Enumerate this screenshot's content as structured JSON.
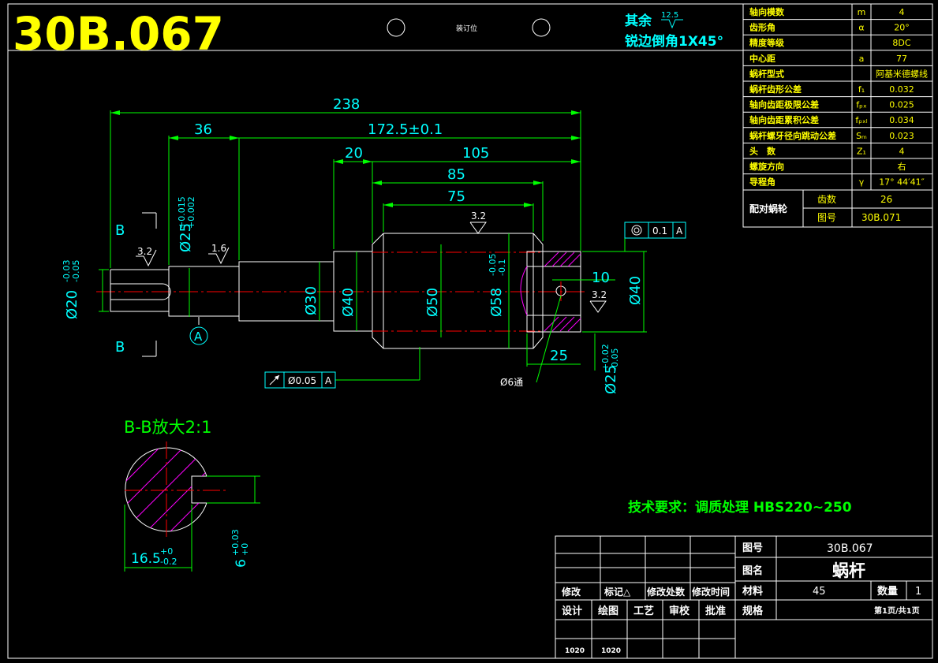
{
  "drawing_number_big": "30B.067",
  "binding_mark": "装订位",
  "surface_note": {
    "line1": "其余",
    "line1_roughness": "12.5",
    "line2": "锐边倒角1X45°"
  },
  "tech_requirement": "技术要求：调质处理 HBS220~250",
  "section_title": "B-B放大2:1",
  "dims": {
    "d238": "238",
    "d36": "36",
    "d172": "172.5±0.1",
    "d20": "20",
    "d105": "105",
    "d85": "85",
    "d75": "75",
    "d10": "10",
    "d25": "25",
    "phi30": "Ø30",
    "phi40a": "Ø40",
    "phi50": "Ø50",
    "phi40b": "Ø40",
    "phi58": "Ø58",
    "phi58_up": "-0.05",
    "phi58_lo": "-0.1",
    "phi20": "Ø20",
    "phi20_up": "-0.03",
    "phi20_lo": "-0.05",
    "phi25a": "Ø25",
    "phi25a_up": "+0.015",
    "phi25a_lo": "+0.002",
    "phi25b": "Ø25",
    "phi25b_up": "+0.02",
    "phi25b_lo": "-0.05",
    "hole": "Ø6通",
    "rough32a": "3.2",
    "rough16": "1.6",
    "rough32b": "3.2",
    "rough32c": "3.2",
    "datum_a": "A",
    "sectionB_top": "B",
    "sectionB_bot": "B",
    "runout_tol": "Ø0.05",
    "runout_ref": "A",
    "conc_tol": "0.1",
    "conc_ref": "A",
    "sec_width": "16.5",
    "sec_width_up": "+0",
    "sec_width_lo": "-0.2",
    "sec_key": "6",
    "sec_key_up": "+0.03",
    "sec_key_lo": "+0"
  },
  "params_table": [
    {
      "name": "轴向模数",
      "sym": "m",
      "val": "4"
    },
    {
      "name": "齿形角",
      "sym": "α",
      "val": "20°"
    },
    {
      "name": "精度等级",
      "sym": "",
      "val": "8DC"
    },
    {
      "name": "中心距",
      "sym": "a",
      "val": "77"
    },
    {
      "name": "蜗杆型式",
      "sym": "",
      "val": "阿基米德螺线"
    },
    {
      "name": "蜗杆齿形公差",
      "sym": "f₁",
      "val": "0.032"
    },
    {
      "name": "轴向齿距极限公差",
      "sym": "fₚₓ",
      "val": "0.025"
    },
    {
      "name": "轴向齿距累积公差",
      "sym": "fₚₓₗ",
      "val": "0.034"
    },
    {
      "name": "蜗杆螺牙径向跳动公差",
      "sym": "Sₘ",
      "val": "0.023"
    },
    {
      "name": "头　数",
      "sym": "Z₁",
      "val": "4"
    },
    {
      "name": "螺旋方向",
      "sym": "",
      "val": "右"
    },
    {
      "name": "导程角",
      "sym": "γ",
      "val": "17° 44′41″"
    }
  ],
  "mating": {
    "label": "配对蜗轮",
    "teeth_label": "齿数",
    "teeth_val": "26",
    "dwg_label": "图号",
    "dwg_val": "30B.071"
  },
  "title_block": {
    "dwg_no_label": "图号",
    "dwg_no": "30B.067",
    "name_label": "图名",
    "name": "蜗杆",
    "material_label": "材料",
    "material": "45",
    "qty_label": "数量",
    "qty": "1",
    "spec_label": "规格",
    "page": "第1页/共1页",
    "rev_headers": [
      "修改",
      "标记△",
      "修改处数",
      "修改时间"
    ],
    "sign_headers": [
      "设计",
      "绘图",
      "工艺",
      "审校",
      "批准"
    ],
    "sign_dates": [
      "1020",
      "1020"
    ]
  }
}
